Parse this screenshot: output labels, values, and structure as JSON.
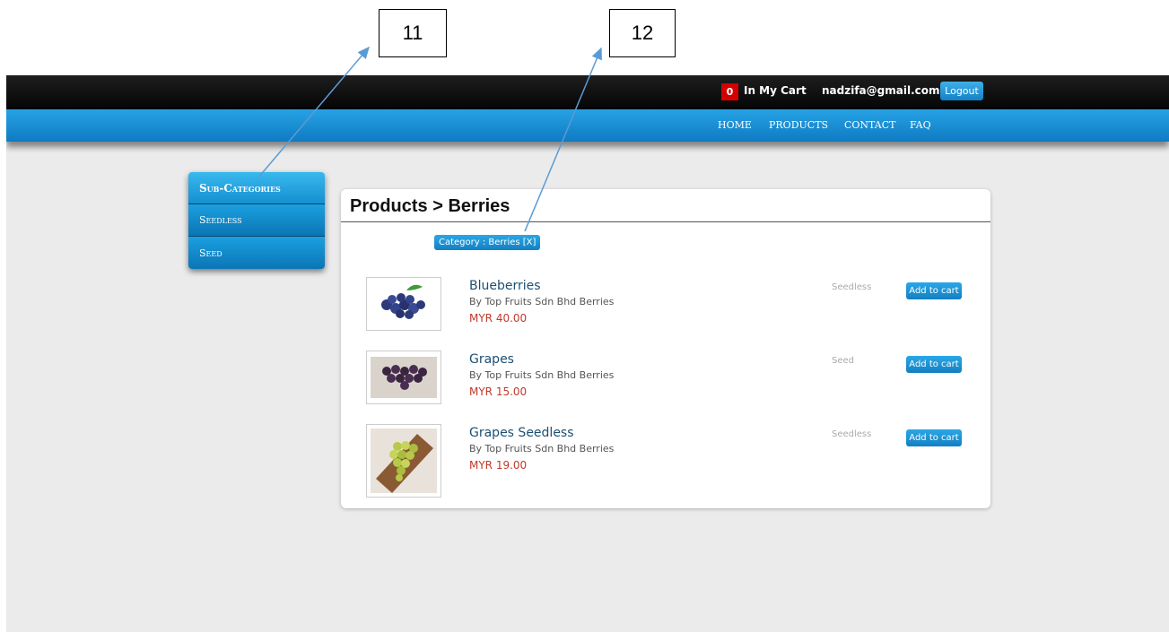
{
  "annotations": {
    "callout_1": "11",
    "callout_2": "12"
  },
  "topbar": {
    "cart_count": "0",
    "cart_label": "In My Cart",
    "user_email": "nadzifa@gmail.com",
    "logout_label": "Logout"
  },
  "nav": {
    "items": [
      {
        "label": "HOME"
      },
      {
        "label": "PRODUCTS"
      },
      {
        "label": "CONTACT"
      },
      {
        "label": "FAQ"
      }
    ]
  },
  "sidebar": {
    "header": "Sub-Categories",
    "items": [
      {
        "label": "Seedless"
      },
      {
        "label": "Seed"
      }
    ]
  },
  "main": {
    "title": "Products > Berries",
    "filter_tag": "Category : Berries [X]",
    "products": [
      {
        "name": "Blueberries",
        "vendor": "By Top Fruits Sdn Bhd Berries",
        "price": "MYR 40.00",
        "subcategory": "Seedless",
        "cart_label": "Add to cart"
      },
      {
        "name": "Grapes",
        "vendor": "By Top Fruits Sdn Bhd Berries",
        "price": "MYR 15.00",
        "subcategory": "Seed",
        "cart_label": "Add to cart"
      },
      {
        "name": "Grapes Seedless",
        "vendor": "By Top Fruits Sdn Bhd Berries",
        "price": "MYR 19.00",
        "subcategory": "Seedless",
        "cart_label": "Add to cart"
      }
    ]
  },
  "colors": {
    "accent": "#1a8fd6",
    "topbar": "#0a0a0a",
    "price": "#c0392b",
    "cart_badge": "#d40000",
    "background": "#ecebeb"
  }
}
